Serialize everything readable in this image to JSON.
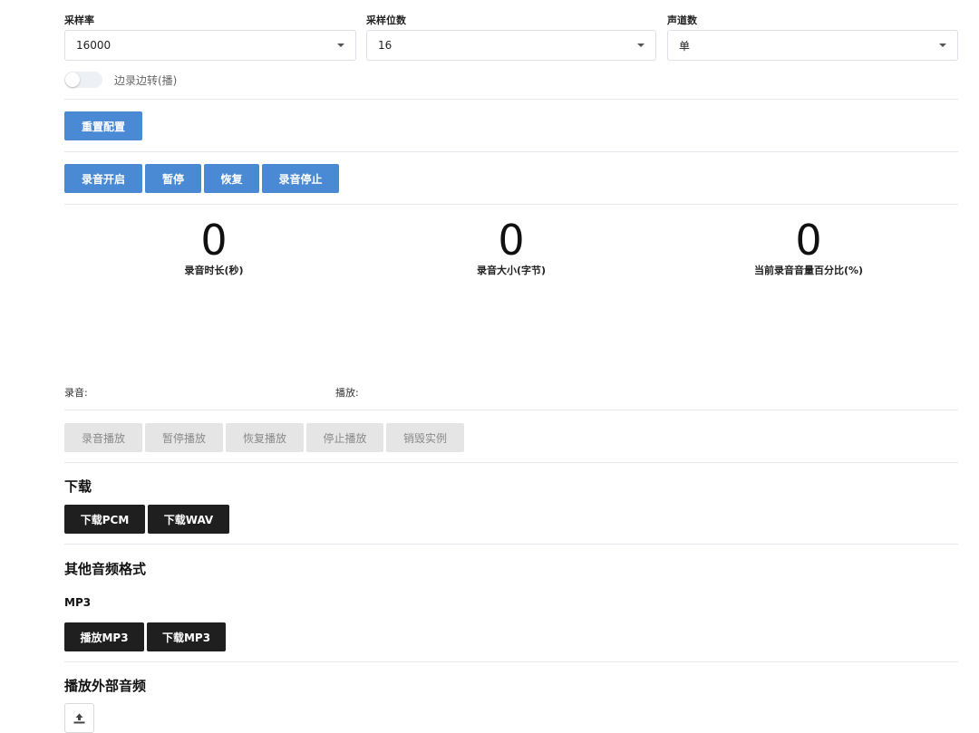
{
  "config": {
    "sample_rate": {
      "label": "采样率",
      "value": "16000"
    },
    "bit_depth": {
      "label": "采样位数",
      "value": "16"
    },
    "channels": {
      "label": "声道数",
      "value": "单"
    },
    "toggle": {
      "label": "边录边转(播)",
      "on": false
    },
    "reset_label": "重置配置"
  },
  "controls": {
    "start": "录音开启",
    "pause": "暂停",
    "resume": "恢复",
    "stop": "录音停止"
  },
  "stats": [
    {
      "value": "0",
      "label": "录音时长(秒)"
    },
    {
      "value": "0",
      "label": "录音大小(字节)"
    },
    {
      "value": "0",
      "label": "当前录音音量百分比(%)"
    }
  ],
  "players": {
    "record_label": "录音:",
    "play_label": "播放:"
  },
  "playback": {
    "play": "录音播放",
    "pause": "暂停播放",
    "resume": "恢复播放",
    "stop": "停止播放",
    "destroy": "销毁实例"
  },
  "download": {
    "heading": "下载",
    "pcm": "下载PCM",
    "wav": "下载WAV"
  },
  "other_formats": {
    "heading": "其他音频格式",
    "mp3_title": "MP3",
    "play_mp3": "播放MP3",
    "download_mp3": "下载MP3"
  },
  "external": {
    "heading": "播放外部音频",
    "upload_icon": "upload-icon"
  },
  "colors": {
    "primary": "#4a8ad4",
    "dark": "#1f1f1f",
    "disabled": "#e5e5e5"
  }
}
